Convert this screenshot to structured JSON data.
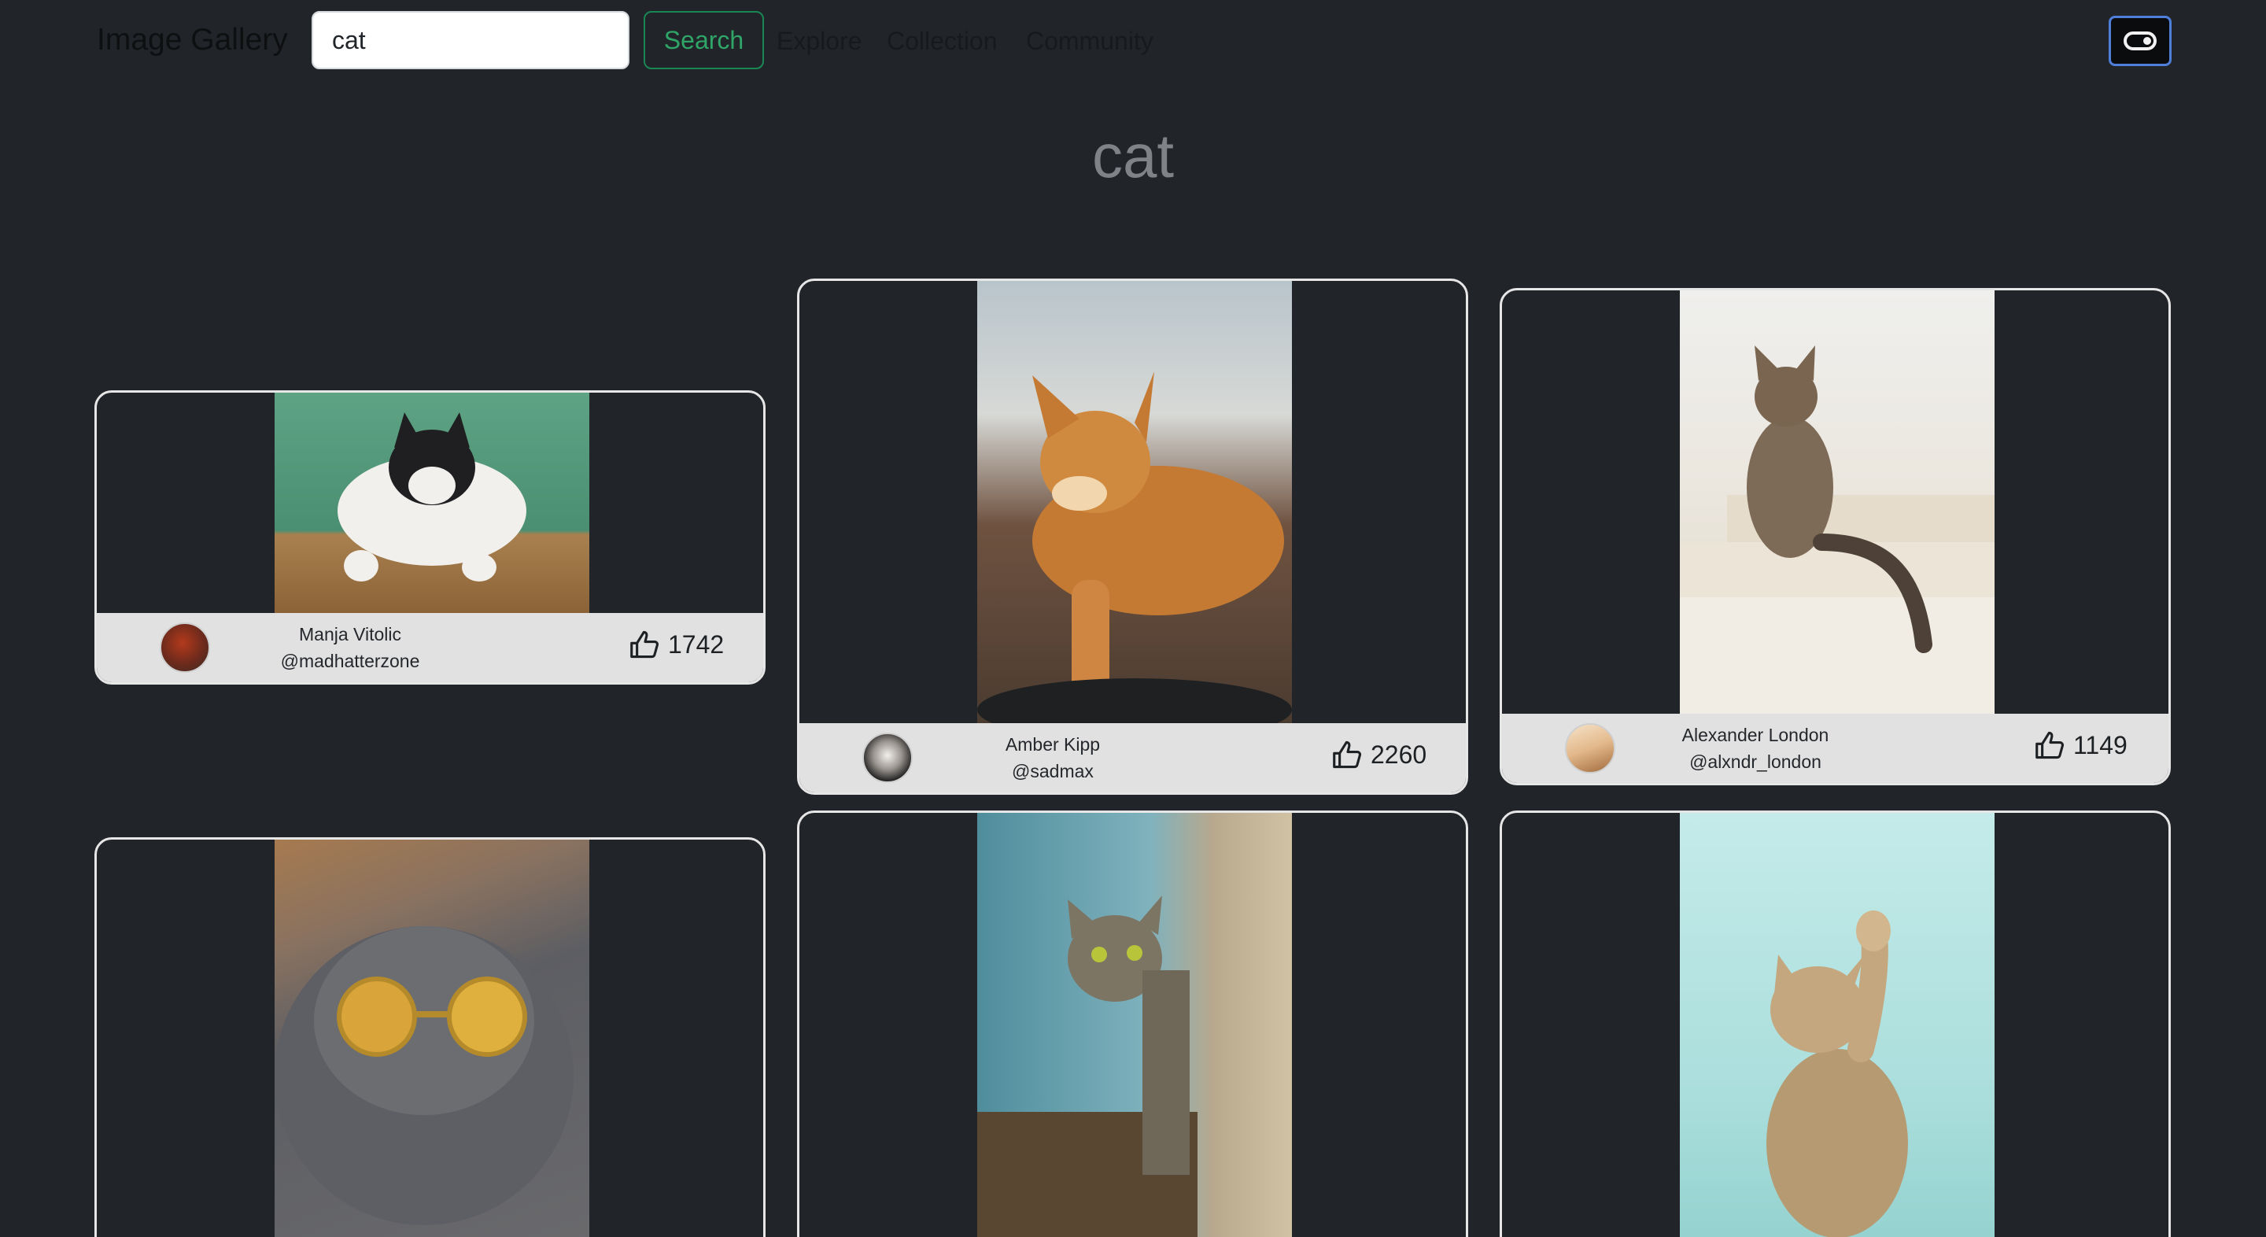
{
  "navbar": {
    "brand": "Image Gallery",
    "search_value": "cat",
    "search_button": "Search",
    "links": [
      "Explore",
      "Collection",
      "Community"
    ],
    "theme_toggle_icon": "toggle-switch-icon"
  },
  "heading": "cat",
  "cards": [
    {
      "name": "Manja Vitolic",
      "username": "@madhatterzone",
      "likes": "1742",
      "photo_subject": "black and white cat on a wooden box, green background",
      "photo_colors": [
        "#5fa487",
        "#3f7d64",
        "#b58a53"
      ],
      "avatar_colors": [
        "#b33a1c",
        "#3b2a24"
      ]
    },
    {
      "name": "Amber Kipp",
      "username": "@sadmax",
      "likes": "2260",
      "photo_subject": "orange tabby cat lying on a table",
      "photo_colors": [
        "#b8c2c8",
        "#c47a34",
        "#5a4a3a"
      ],
      "avatar_colors": [
        "#f3f0ea",
        "#1c1c1c"
      ]
    },
    {
      "name": "Alexander London",
      "username": "@alxndr_london",
      "likes": "1149",
      "photo_subject": "tabby cat sitting on white stairs",
      "photo_colors": [
        "#ecebe8",
        "#d9d2c4",
        "#7a6652"
      ],
      "avatar_colors": [
        "#f1d2b0",
        "#a06a3c"
      ]
    },
    {
      "photo_subject": "grey scottish fold cat wearing sunglasses",
      "photo_colors": [
        "#5d5e63",
        "#8c8a88",
        "#d9a43a"
      ]
    },
    {
      "photo_subject": "tabby cat peeking from behind a wall",
      "photo_colors": [
        "#5e9aa8",
        "#7fb2bd",
        "#c9b79a"
      ]
    },
    {
      "photo_subject": "tabby kitten reaching up, mint background",
      "photo_colors": [
        "#a9dedd",
        "#c9ecea",
        "#b69a72"
      ]
    }
  ],
  "accent_colors": {
    "background": "#212429",
    "success": "#198754",
    "footer": "#e1e1e1",
    "toggle_border": "#4f7fd9"
  }
}
